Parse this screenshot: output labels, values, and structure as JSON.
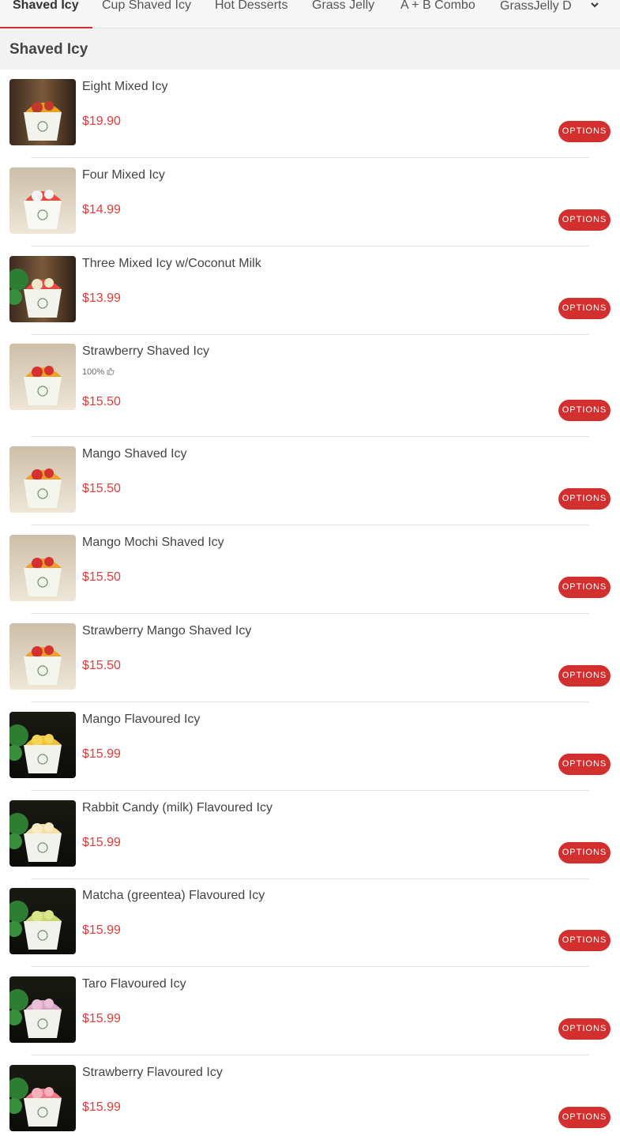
{
  "tabs": [
    {
      "label": "Shaved Icy",
      "active": true
    },
    {
      "label": "Cup Shaved Icy",
      "active": false
    },
    {
      "label": "Hot Desserts",
      "active": false
    },
    {
      "label": "Grass Jelly",
      "active": false
    },
    {
      "label": "A + B Combo",
      "active": false
    }
  ],
  "tab_dropdown": {
    "label": "GrassJelly D"
  },
  "section": {
    "title": "Shaved Icy"
  },
  "options_label": "OPTIONS",
  "items": [
    {
      "name": "Eight Mixed Icy",
      "price": "$19.90",
      "rating": ""
    },
    {
      "name": "Four Mixed Icy",
      "price": "$14.99",
      "rating": ""
    },
    {
      "name": "Three Mixed Icy w/Coconut Milk",
      "price": "$13.99",
      "rating": ""
    },
    {
      "name": "Strawberry Shaved Icy",
      "price": "$15.50",
      "rating": "100%"
    },
    {
      "name": "Mango Shaved Icy",
      "price": "$15.50",
      "rating": ""
    },
    {
      "name": "Mango Mochi Shaved Icy",
      "price": "$15.50",
      "rating": ""
    },
    {
      "name": "Strawberry Mango Shaved Icy",
      "price": "$15.50",
      "rating": ""
    },
    {
      "name": "Mango Flavoured Icy",
      "price": "$15.99",
      "rating": ""
    },
    {
      "name": "Rabbit Candy (milk) Flavoured Icy",
      "price": "$15.99",
      "rating": ""
    },
    {
      "name": "Matcha (greentea) Flavoured Icy",
      "price": "$15.99",
      "rating": ""
    },
    {
      "name": "Taro Flavoured Icy",
      "price": "$15.99",
      "rating": ""
    },
    {
      "name": "Strawberry Flavoured Icy",
      "price": "$15.99",
      "rating": ""
    }
  ],
  "colors": {
    "accent": "#d32f2f",
    "price": "#e53935"
  },
  "icons": {
    "dropdown": "chevron-down-icon",
    "rating": "thumbs-up-icon"
  }
}
